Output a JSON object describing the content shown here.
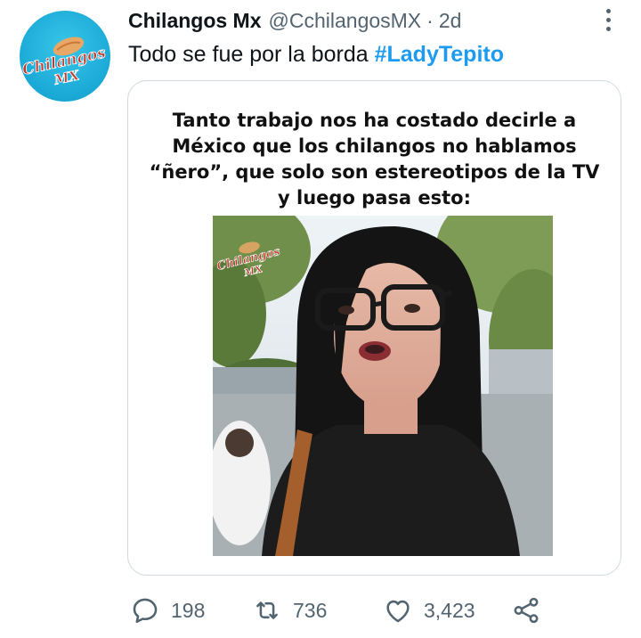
{
  "tweet": {
    "author": {
      "display_name": "Chilangos Mx",
      "handle": "@CchilangosMX",
      "avatar_logo_text": [
        "Chilangos",
        "MX"
      ]
    },
    "separator": "·",
    "time": "2d",
    "text": "Todo se fue por la borda",
    "hashtag": "#LadyTepito",
    "media": {
      "caption_lines": [
        "Tanto trabajo nos ha costado decirle a",
        "México que los chilangos no hablamos",
        "“ñero”, que solo son estereotipos de la TV",
        "y luego pasa esto:"
      ],
      "watermark_text": [
        "Chilangos",
        "MX"
      ]
    },
    "actions": {
      "reply_count": "198",
      "retweet_count": "736",
      "like_count": "3,423"
    },
    "icons": {
      "more": "more-horizontal-icon",
      "reply": "reply-icon",
      "retweet": "retweet-icon",
      "like": "heart-icon",
      "share": "share-icon"
    },
    "colors": {
      "accent": "#1d9bf0",
      "secondary_text": "#536471",
      "border": "#cfd9de",
      "avatar_bg": "#1aa9d6"
    }
  }
}
